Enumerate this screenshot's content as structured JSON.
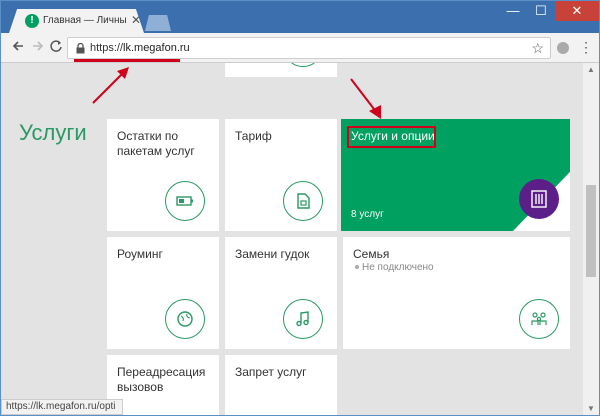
{
  "browser": {
    "tab_title": "Главная — Личный каб",
    "favicon_letter": "!",
    "tab_close": "✕",
    "window_min": "—",
    "window_max": "☐",
    "window_close": "✕",
    "url_scheme": "https://",
    "url_host": "lk.megafon.ru",
    "status_url": "https://lk.megafon.ru/opti",
    "icons": {
      "back": "back-arrow-icon",
      "forward": "forward-arrow-icon",
      "reload": "reload-icon",
      "lock": "lock-icon",
      "star": "star-icon",
      "menu": "kebab-menu-icon"
    }
  },
  "page": {
    "section_title": "Услуги",
    "cards": [
      {
        "label": "Остатки по пакетам услуг",
        "icon": "battery-icon"
      },
      {
        "label": "Тариф",
        "icon": "sim-card-icon"
      },
      {
        "label": "Роуминг",
        "icon": "globe-icon"
      },
      {
        "label": "Замени гудок",
        "icon": "music-note-icon"
      },
      {
        "label": "Семья",
        "note": "Не подключено",
        "icon": "family-icon"
      },
      {
        "label": "Переадресация вызовов"
      },
      {
        "label": "Запрет услуг"
      }
    ],
    "featured": {
      "title": "Услуги и опции",
      "count": "8 услуг",
      "icon": "options-icon"
    }
  },
  "colors": {
    "brand_green": "#00a060",
    "brand_purple": "#5c1e88",
    "annotation_red": "#d0011b",
    "titlebar_blue": "#3b6fae"
  }
}
